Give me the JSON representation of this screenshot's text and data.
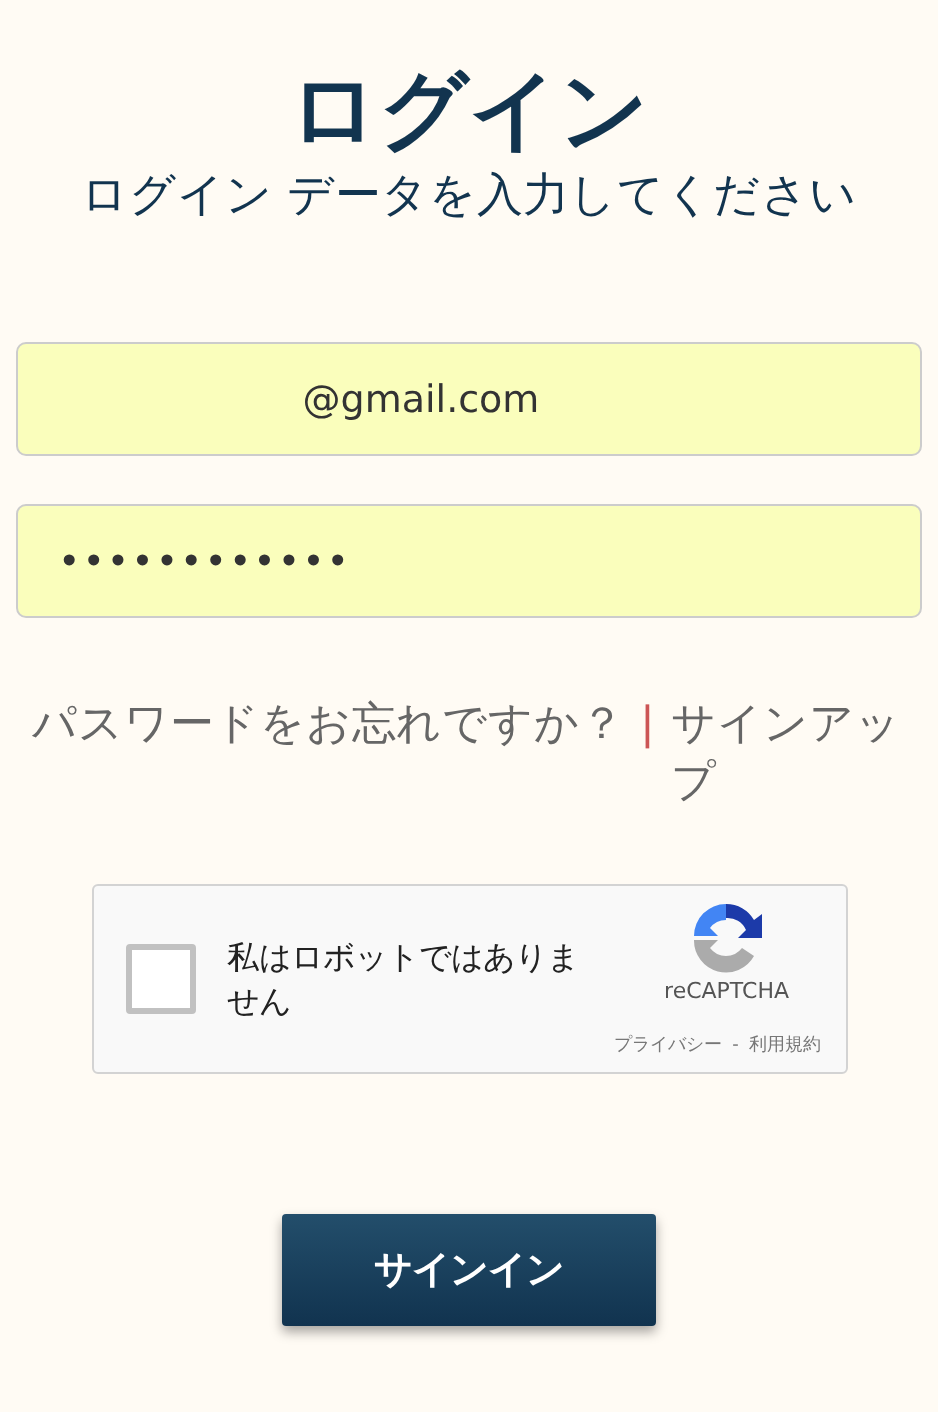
{
  "title": "ログイン",
  "subtitle": "ログイン データを入力してください",
  "fields": [
    {
      "kind": "email",
      "value": "@gmail.com"
    },
    {
      "kind": "password",
      "value": "••••••••••••"
    }
  ],
  "links": {
    "forgot": "パスワードをお忘れですか？",
    "separator": "|",
    "signup": "サインアップ"
  },
  "captcha": {
    "checked": false,
    "label": "私はロボットではありません",
    "brand": "reCAPTCHA",
    "privacy": "プライバシー",
    "dash": "-",
    "terms": "利用規約"
  },
  "button": "サインイン"
}
